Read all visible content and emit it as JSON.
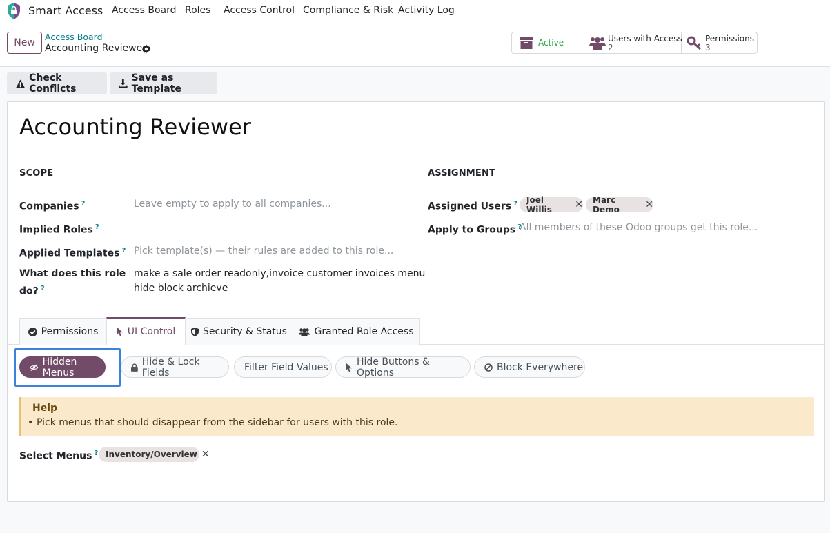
{
  "navbar": {
    "app_name": "Smart Access",
    "items": [
      "Access Board",
      "Roles",
      "Access Control",
      "Compliance & Risk",
      "Activity Log"
    ]
  },
  "control_panel": {
    "new_label": "New",
    "breadcrumb_parent": "Access Board",
    "breadcrumb_current": "Accounting Reviewer",
    "stats": {
      "active_label": "Active",
      "users_label": "Users with Access",
      "users_value": "2",
      "perms_label": "Permissions",
      "perms_value": "3"
    }
  },
  "actions": {
    "check_conflicts": "Check Conflicts",
    "save_template": "Save as Template"
  },
  "form": {
    "title": "Accounting Reviewer",
    "scope_heading": "SCOPE",
    "assignment_heading": "ASSIGNMENT",
    "companies_label": "Companies",
    "companies_placeholder": "Leave empty to apply to all companies...",
    "implied_roles_label": "Implied Roles",
    "applied_templates_label": "Applied Templates",
    "applied_templates_placeholder": "Pick template(s) — their rules are added to this role...",
    "what_does_label_1": "What does this role",
    "what_does_label_2": "do?",
    "what_does_value_1": "make a sale order readonly,invoice customer invoices menu",
    "what_does_value_2": "hide block archieve",
    "assigned_users_label": "Assigned Users",
    "assigned_users": [
      "Joel Willis",
      "Marc Demo"
    ],
    "apply_groups_label": "Apply to Groups",
    "apply_groups_placeholder": "All members of these Odoo groups get this role...",
    "help_marker": "?"
  },
  "tabs": [
    "Permissions",
    "UI Control",
    "Security & Status",
    "Granted Role Access"
  ],
  "pills": [
    "Hidden Menus",
    "Hide & Lock Fields",
    "Filter Field Values",
    "Hide Buttons & Options",
    "Block Everywhere"
  ],
  "help": {
    "title": "Help",
    "item": "Pick menus that should disappear from the sidebar for users with this role."
  },
  "select_menus": {
    "label": "Select Menus",
    "tags": [
      "Inventory/Overview"
    ]
  },
  "colors": {
    "brand": "#714b67",
    "teal": "#017e84",
    "active_green": "#28a745",
    "focus_blue": "#3b82d9"
  }
}
